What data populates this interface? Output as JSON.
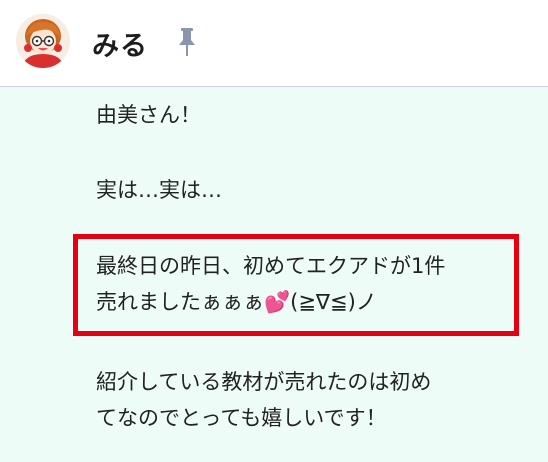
{
  "header": {
    "name": "みる",
    "avatar_icon": "girl-avatar-icon",
    "pin_icon": "pin-icon"
  },
  "messages": [
    {
      "lines": [
        "由美さん！"
      ]
    },
    {
      "lines": [
        "実は…実は…"
      ]
    },
    {
      "lines": [
        "最終日の昨日、初めてエクアドが1件",
        "売れましたぁぁぁ💕(≧∇≦)ノ"
      ],
      "highlighted": true
    },
    {
      "lines": [
        "紹介している教材が売れたのは初め",
        "てなのでとっても嬉しいです！"
      ]
    }
  ],
  "colors": {
    "chat_background": "#eefcf8",
    "highlight_border": "#e60012",
    "pin": "#8a96ad"
  }
}
